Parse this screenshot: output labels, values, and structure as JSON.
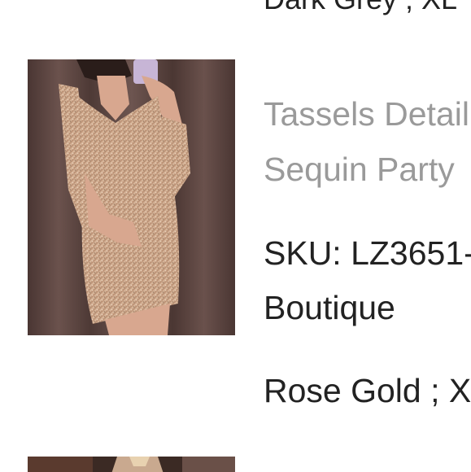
{
  "previous_item": {
    "variant": "Dark Grey ; XL"
  },
  "product": {
    "image_alt": "Sequin dress with tassel sleeves",
    "title_line_1": "Tassels Detail",
    "title_line_2": "Sequin Party",
    "sku": "SKU: LZ3651-",
    "vendor": "Boutique",
    "variant": "Rose Gold ; XL"
  },
  "next_item": {
    "image_alt": "Next product image"
  }
}
